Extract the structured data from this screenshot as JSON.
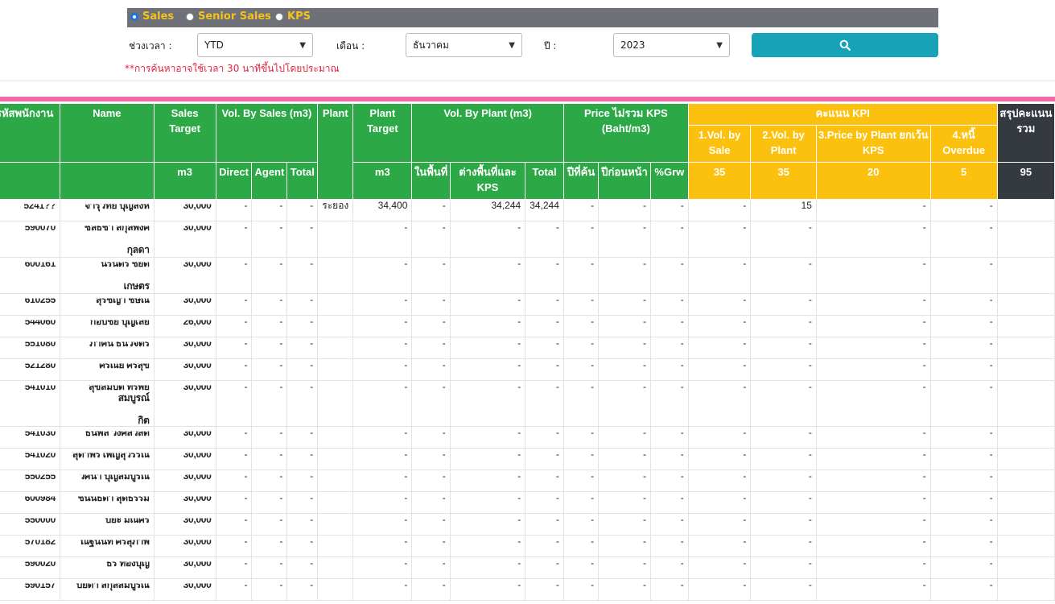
{
  "filters": {
    "radios": [
      {
        "label": "Sales",
        "checked": true
      },
      {
        "label": "Senior Sales",
        "checked": false
      },
      {
        "label": "KPS",
        "checked": false
      }
    ],
    "period_label": "ช่วงเวลา :",
    "period_value": "YTD",
    "month_label": "เดือน :",
    "month_value": "ธันวาคม",
    "year_label": "ปี :",
    "year_value": "2023",
    "search_icon": "search-icon",
    "warning": "**การค้นหาอาจใช้เวลา 30 นาทีขึ้นไปโดยประมาณ"
  },
  "colors": {
    "green_header": "#2ca846",
    "yellow_header": "#fcc10f",
    "dark_header": "#343a40",
    "search_button": "#17a2b8",
    "accent_line": "#f06aa8",
    "warning_text": "#e0243d"
  },
  "table": {
    "headers": {
      "emp_id": "รหัสพนักงาน",
      "name": "Name",
      "sales_target": "Sales Target",
      "vol_by_sales": "Vol. By Sales (m3)",
      "plant": "Plant",
      "plant_target": "Plant Target",
      "vol_by_plant": "Vol. By Plant (m3)",
      "price": "Price ไม่รวม KPS (Baht/m3)",
      "kpi": "คะแนน KPI",
      "kpi1": "1.Vol. by Sale",
      "kpi2": "2.Vol. by Plant",
      "kpi3": "3.Price by Plant ยกเว้น KPS",
      "kpi4": "4.หนี้ Overdue",
      "summary": "สรุปคะแนนรวม",
      "sales_unit": "m3",
      "direct": "Direct",
      "agent": "Agent",
      "total": "Total",
      "plant_unit": "m3",
      "in_area": "ในพื้นที่",
      "out_area": "ต่างพื้นที่และ KPS",
      "plant_total": "Total",
      "this_year": "ปีที่ค้น",
      "prev_year": "ปีก่อนหน้า",
      "growth": "%Grw",
      "w1": "35",
      "w2": "35",
      "w3": "20",
      "w4": "5",
      "wsum": "95"
    },
    "rows": [
      {
        "id": "5241??",
        "name1": "จารุวิทย์ บุญสิงห์",
        "name2": "",
        "target": "30,000",
        "direct": "-",
        "agent": "-",
        "total": "-",
        "plant": "ระยอง",
        "ptarget": "34,400",
        "in": "-",
        "out": "34,244",
        "ptotal": "34,244",
        "y1": "-",
        "y0": "-",
        "grw": "-",
        "k1": "-",
        "k2": "15",
        "k3": "-",
        "k4": "-"
      },
      {
        "id": "590070",
        "name1": "ชลธิชา สกุลพงศ์",
        "name2": "กุลดา",
        "target": "30,000",
        "direct": "-",
        "agent": "-",
        "total": "-",
        "plant": "",
        "ptarget": "-",
        "in": "-",
        "out": "-",
        "ptotal": "-",
        "y1": "-",
        "y0": "-",
        "grw": "-",
        "k1": "-",
        "k2": "-",
        "k3": "-",
        "k4": "-"
      },
      {
        "id": "600161",
        "name1": "นิรันดร์ ชัยดี",
        "name2": "เกษตร",
        "target": "30,000",
        "direct": "-",
        "agent": "-",
        "total": "-",
        "plant": "",
        "ptarget": "-",
        "in": "-",
        "out": "-",
        "ptotal": "-",
        "y1": "-",
        "y0": "-",
        "grw": "-",
        "k1": "-",
        "k2": "-",
        "k3": "-",
        "k4": "-"
      },
      {
        "id": "610255",
        "name1": "สุรัชญา ชิษณ์",
        "name2": "",
        "target": "30,000",
        "direct": "-",
        "agent": "-",
        "total": "-",
        "plant": "",
        "ptarget": "-",
        "in": "-",
        "out": "-",
        "ptotal": "-",
        "y1": "-",
        "y0": "-",
        "grw": "-",
        "k1": "-",
        "k2": "-",
        "k3": "-",
        "k4": "-"
      },
      {
        "id": "544060",
        "name1": "กอบชัย บุญเลย",
        "name2": "",
        "target": "26,000",
        "direct": "-",
        "agent": "-",
        "total": "-",
        "plant": "",
        "ptarget": "-",
        "in": "-",
        "out": "-",
        "ptotal": "-",
        "y1": "-",
        "y0": "-",
        "grw": "-",
        "k1": "-",
        "k2": "-",
        "k3": "-",
        "k4": "-"
      },
      {
        "id": "551080",
        "name1": "ภาคิน ธนวิจิตร",
        "name2": "",
        "target": "30,000",
        "direct": "-",
        "agent": "-",
        "total": "-",
        "plant": "",
        "ptarget": "-",
        "in": "-",
        "out": "-",
        "ptotal": "-",
        "y1": "-",
        "y0": "-",
        "grw": "-",
        "k1": "-",
        "k2": "-",
        "k3": "-",
        "k4": "-"
      },
      {
        "id": "521280",
        "name1": "ศรัณย์ ศรีสุข",
        "name2": "",
        "target": "30,000",
        "direct": "-",
        "agent": "-",
        "total": "-",
        "plant": "",
        "ptarget": "-",
        "in": "-",
        "out": "-",
        "ptotal": "-",
        "y1": "-",
        "y0": "-",
        "grw": "-",
        "k1": "-",
        "k2": "-",
        "k3": "-",
        "k4": "-"
      },
      {
        "id": "541010",
        "name1": "สุขสมบัติ ทรัพย์สมบูรณ์",
        "name2": "กิต",
        "target": "30,000",
        "direct": "-",
        "agent": "-",
        "total": "-",
        "plant": "",
        "ptarget": "-",
        "in": "-",
        "out": "-",
        "ptotal": "-",
        "y1": "-",
        "y0": "-",
        "grw": "-",
        "k1": "-",
        "k2": "-",
        "k3": "-",
        "k4": "-"
      },
      {
        "id": "541030",
        "name1": "ธนพล วงศ์สวัสดิ์",
        "name2": "",
        "target": "30,000",
        "direct": "-",
        "agent": "-",
        "total": "-",
        "plant": "",
        "ptarget": "-",
        "in": "-",
        "out": "-",
        "ptotal": "-",
        "y1": "-",
        "y0": "-",
        "grw": "-",
        "k1": "-",
        "k2": "-",
        "k3": "-",
        "k4": "-"
      },
      {
        "id": "541020",
        "name1": "สุดาพร เพ็ญสุวรรณ",
        "name2": "",
        "target": "30,000",
        "direct": "-",
        "agent": "-",
        "total": "-",
        "plant": "",
        "ptarget": "-",
        "in": "-",
        "out": "-",
        "ptotal": "-",
        "y1": "-",
        "y0": "-",
        "grw": "-",
        "k1": "-",
        "k2": "-",
        "k3": "-",
        "k4": "-"
      },
      {
        "id": "550255",
        "name1": "วศินา บุญสมบูรณ์",
        "name2": "",
        "target": "30,000",
        "direct": "-",
        "agent": "-",
        "total": "-",
        "plant": "",
        "ptarget": "-",
        "in": "-",
        "out": "-",
        "ptotal": "-",
        "y1": "-",
        "y0": "-",
        "grw": "-",
        "k1": "-",
        "k2": "-",
        "k3": "-",
        "k4": "-"
      },
      {
        "id": "600984",
        "name1": "ชนันธิดา สุดธรรม",
        "name2": "",
        "target": "30,000",
        "direct": "-",
        "agent": "-",
        "total": "-",
        "plant": "",
        "ptarget": "-",
        "in": "-",
        "out": "-",
        "ptotal": "-",
        "y1": "-",
        "y0": "-",
        "grw": "-",
        "k1": "-",
        "k2": "-",
        "k3": "-",
        "k4": "-"
      },
      {
        "id": "550000",
        "name1": "ปิยะ มณีศรี",
        "name2": "",
        "target": "30,000",
        "direct": "-",
        "agent": "-",
        "total": "-",
        "plant": "",
        "ptarget": "-",
        "in": "-",
        "out": "-",
        "ptotal": "-",
        "y1": "-",
        "y0": "-",
        "grw": "-",
        "k1": "-",
        "k2": "-",
        "k3": "-",
        "k4": "-"
      },
      {
        "id": "570182",
        "name1": "ณฐินันท์ ศรีสุภาพ",
        "name2": "",
        "target": "30,000",
        "direct": "-",
        "agent": "-",
        "total": "-",
        "plant": "",
        "ptarget": "-",
        "in": "-",
        "out": "-",
        "ptotal": "-",
        "y1": "-",
        "y0": "-",
        "grw": "-",
        "k1": "-",
        "k2": "-",
        "k3": "-",
        "k4": "-"
      },
      {
        "id": "590020",
        "name1": "ธีร์ ทองบุญ",
        "name2": "",
        "target": "30,000",
        "direct": "-",
        "agent": "-",
        "total": "-",
        "plant": "",
        "ptarget": "-",
        "in": "-",
        "out": "-",
        "ptotal": "-",
        "y1": "-",
        "y0": "-",
        "grw": "-",
        "k1": "-",
        "k2": "-",
        "k3": "-",
        "k4": "-"
      },
      {
        "id": "590157",
        "name1": "ปิยดา สกุลสมบูรณ์",
        "name2": "",
        "target": "30,000",
        "direct": "-",
        "agent": "-",
        "total": "-",
        "plant": "",
        "ptarget": "-",
        "in": "-",
        "out": "-",
        "ptotal": "-",
        "y1": "-",
        "y0": "-",
        "grw": "-",
        "k1": "-",
        "k2": "-",
        "k3": "-",
        "k4": "-"
      }
    ]
  }
}
